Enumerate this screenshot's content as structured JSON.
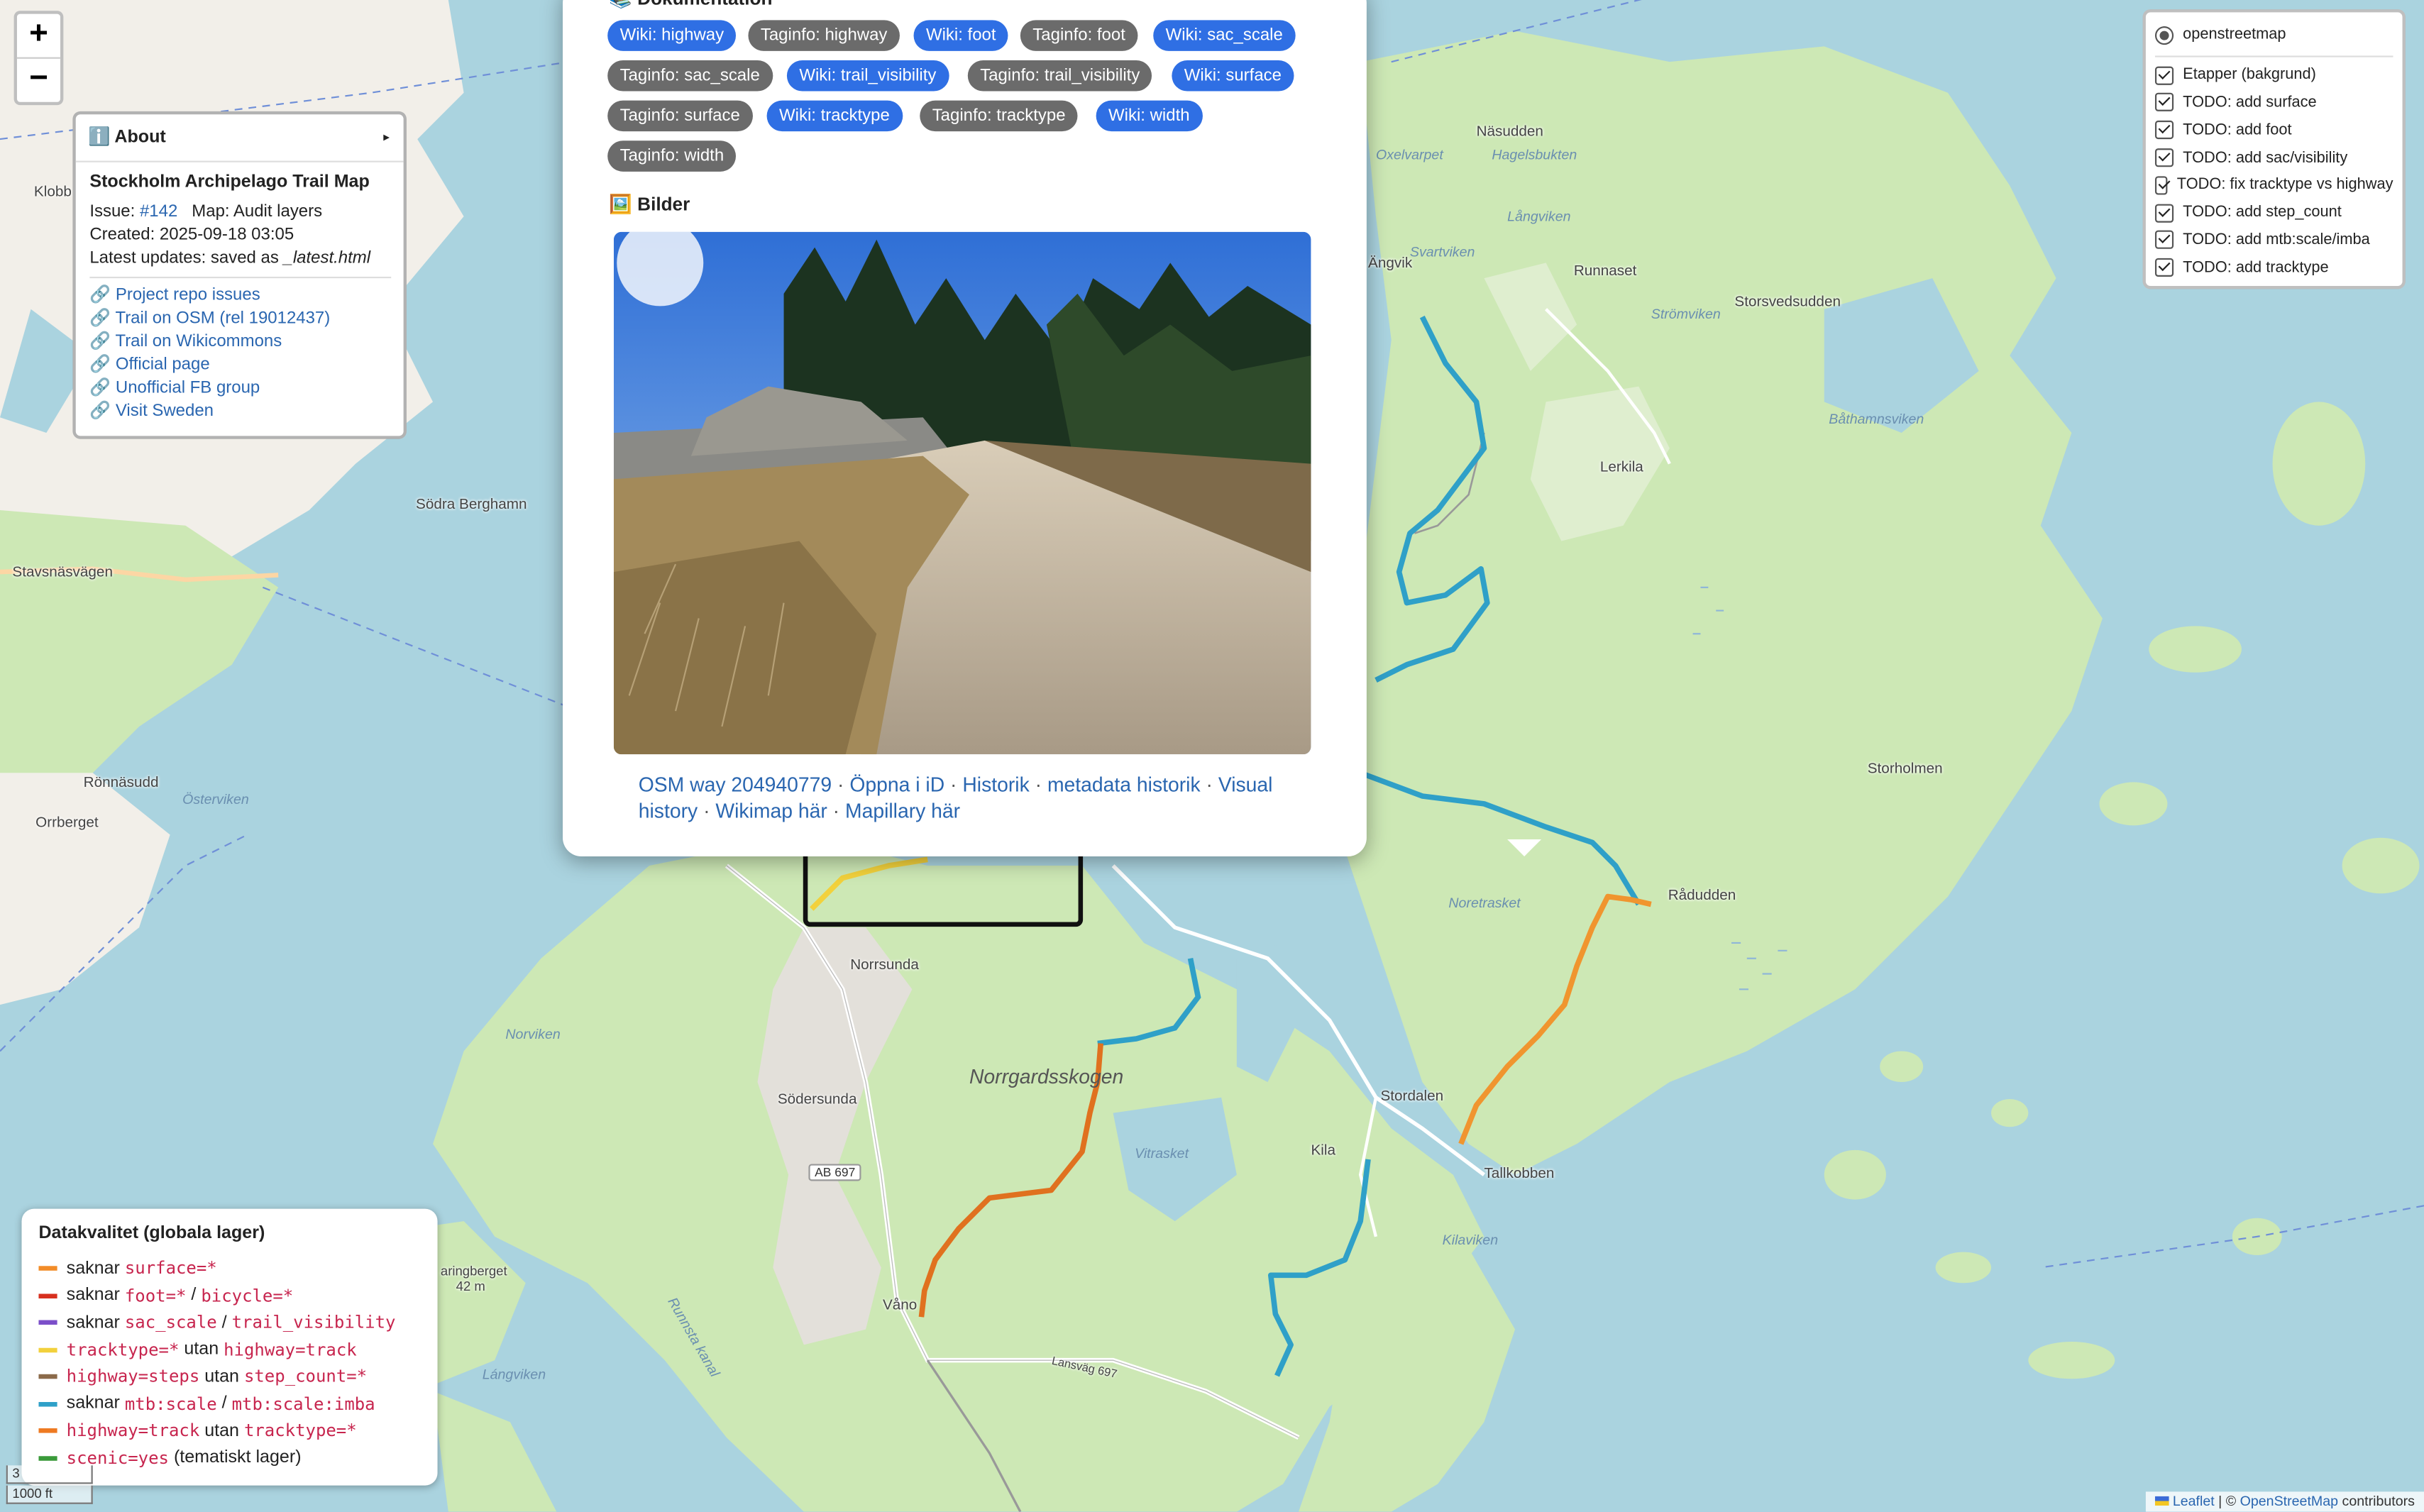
{
  "zoom": {
    "in": "+",
    "out": "−"
  },
  "about": {
    "header": "ℹ️ About",
    "arrow": "▸",
    "title": "Stockholm Archipelago Trail Map",
    "issue_label": "Issue: ",
    "issue_link": "#142",
    "map_label": "Map: Audit layers",
    "created": "Created: 2025-09-18 03:05",
    "updates_prefix": "Latest updates: saved as ",
    "updates_file": "_latest.html",
    "links": [
      {
        "icon": "🔗",
        "label": "Project repo issues"
      },
      {
        "icon": "🔗",
        "label": "Trail on OSM (rel 19012437)"
      },
      {
        "icon": "🔗",
        "label": "Trail on Wikicommons"
      },
      {
        "icon": "🔗",
        "label": "Official page"
      },
      {
        "icon": "🔗",
        "label": "Unofficial FB group"
      },
      {
        "icon": "🔗",
        "label": "Visit Sweden"
      }
    ]
  },
  "layers": {
    "base": "openstreetmap",
    "overlays": [
      "Etapper (bakgrund)",
      "TODO: add surface",
      "TODO: add foot",
      "TODO: add sac/visibility",
      "TODO: fix tracktype vs highway",
      "TODO: add step_count",
      "TODO: add mtb:scale/imba",
      "TODO: add tracktype"
    ]
  },
  "popup": {
    "doc_heading": "📚 Dokumentation",
    "pills": [
      {
        "label": "Wiki: highway",
        "kind": "wiki"
      },
      {
        "label": "Taginfo: highway",
        "kind": "tag"
      },
      {
        "label": "Wiki: foot",
        "kind": "wiki"
      },
      {
        "label": "Taginfo: foot",
        "kind": "tag"
      },
      {
        "label": "Wiki: sac_scale",
        "kind": "wiki"
      },
      {
        "label": "Taginfo: sac_scale",
        "kind": "tag"
      },
      {
        "label": "Wiki: trail_visibility",
        "kind": "wiki"
      },
      {
        "label": "Taginfo: trail_visibility",
        "kind": "tag"
      },
      {
        "label": "Wiki: surface",
        "kind": "wiki"
      },
      {
        "label": "Taginfo: surface",
        "kind": "tag"
      },
      {
        "label": "Wiki: tracktype",
        "kind": "wiki"
      },
      {
        "label": "Taginfo: tracktype",
        "kind": "tag"
      },
      {
        "label": "Wiki: width",
        "kind": "wiki"
      },
      {
        "label": "Taginfo: width",
        "kind": "tag"
      }
    ],
    "images_heading": "🖼️ Bilder",
    "links": {
      "osm_way": "OSM way 204940779",
      "sep": " · ",
      "open_id": "Öppna i iD",
      "history": "Historik",
      "meta_history": "metadata historik",
      "visual_history": "Visual history",
      "wikimap": "Wikimap här",
      "mapillary": "Mapillary här"
    }
  },
  "legend": {
    "title": "Datakvalitet (globala lager)",
    "rows": [
      {
        "color": "#f28c28",
        "parts": [
          [
            "t",
            "saknar "
          ],
          [
            "c",
            "surface=*"
          ]
        ]
      },
      {
        "color": "#d7301f",
        "parts": [
          [
            "t",
            "saknar "
          ],
          [
            "c",
            "foot=*"
          ],
          [
            "t",
            " / "
          ],
          [
            "c",
            "bicycle=*"
          ]
        ]
      },
      {
        "color": "#7b4fc9",
        "parts": [
          [
            "t",
            "saknar "
          ],
          [
            "c",
            "sac_scale"
          ],
          [
            "t",
            " / "
          ],
          [
            "c",
            "trail_visibility"
          ]
        ]
      },
      {
        "color": "#f2d13c",
        "parts": [
          [
            "c",
            "tracktype=*"
          ],
          [
            "t",
            " utan "
          ],
          [
            "c",
            "highway=track"
          ]
        ]
      },
      {
        "color": "#8b6a4a",
        "parts": [
          [
            "c",
            "highway=steps"
          ],
          [
            "t",
            " utan "
          ],
          [
            "c",
            "step_count=*"
          ]
        ]
      },
      {
        "color": "#2fa0c8",
        "parts": [
          [
            "t",
            "saknar "
          ],
          [
            "c",
            "mtb:scale"
          ],
          [
            "t",
            " / "
          ],
          [
            "c",
            "mtb:scale:imba"
          ]
        ]
      },
      {
        "color": "#ee7a22",
        "parts": [
          [
            "c",
            "highway=track"
          ],
          [
            "t",
            " utan "
          ],
          [
            "c",
            "tracktype=*"
          ]
        ]
      },
      {
        "color": "#3a9a3a",
        "parts": [
          [
            "c",
            "scenic=yes"
          ],
          [
            "t",
            " (tematiskt lager)"
          ]
        ]
      }
    ]
  },
  "scale": {
    "top": "3",
    "bottom": "1000 ft"
  },
  "attribution": {
    "leaflet": "Leaflet",
    "sep": " | © ",
    "osm": "OpenStreetMap",
    "suffix": " contributors"
  },
  "places": [
    {
      "name": "Näsudden"
    },
    {
      "name": "Hagelsbukten"
    },
    {
      "name": "Oxelvarpet"
    },
    {
      "name": "Runnaset"
    },
    {
      "name": "Storsvedsudden"
    },
    {
      "name": "Lerkila"
    },
    {
      "name": "Storholmen"
    },
    {
      "name": "Rådudden"
    },
    {
      "name": "Norrsunda"
    },
    {
      "name": "Norrgardsskogen"
    },
    {
      "name": "Södersunda"
    },
    {
      "name": "Stordalen"
    },
    {
      "name": "Kila"
    },
    {
      "name": "Tallkobben"
    },
    {
      "name": "Våno"
    },
    {
      "name": "Södra Berghamn"
    },
    {
      "name": "Stavsnäsvägen"
    },
    {
      "name": "Rönnäsudd"
    },
    {
      "name": "Orrberget"
    },
    {
      "name": "Klobb"
    },
    {
      "name": "Ängvik"
    },
    {
      "name": "Svartviken"
    },
    {
      "name": "Långviken"
    },
    {
      "name": "Strömviken"
    },
    {
      "name": "Båthamnsviken"
    },
    {
      "name": "Noretrasket"
    },
    {
      "name": "Vitrasket"
    },
    {
      "name": "Kilaviken"
    },
    {
      "name": "Norviken"
    },
    {
      "name": "Österviken"
    },
    {
      "name": "Lángviken"
    },
    {
      "name": "Runnsta kanal"
    },
    {
      "name": "aringberget"
    },
    {
      "name": "42 m"
    },
    {
      "name": "Lansväg 697"
    }
  ],
  "roads": {
    "ab697": "AB 697"
  }
}
